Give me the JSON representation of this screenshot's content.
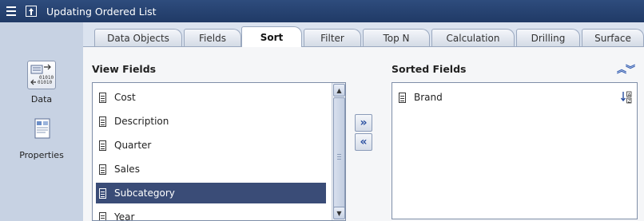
{
  "window": {
    "title": "Updating Ordered List"
  },
  "sidebar": {
    "items": [
      {
        "label": "Data",
        "icon": "data-icon"
      },
      {
        "label": "Properties",
        "icon": "properties-icon"
      }
    ]
  },
  "tabs": [
    {
      "label": "Data Objects"
    },
    {
      "label": "Fields"
    },
    {
      "label": "Sort",
      "active": true
    },
    {
      "label": "Filter"
    },
    {
      "label": "Top N"
    },
    {
      "label": "Calculation"
    },
    {
      "label": "Drilling"
    },
    {
      "label": "Surface"
    }
  ],
  "view_fields": {
    "title": "View Fields",
    "items": [
      "Cost",
      "Description",
      "Quarter",
      "Sales",
      "Subcategory",
      "Year"
    ],
    "selected": "Subcategory"
  },
  "sorted_fields": {
    "title": "Sorted Fields",
    "items": [
      {
        "label": "Brand",
        "order_icon": "sort-ascending-icon"
      }
    ]
  },
  "move_buttons": {
    "add": "»",
    "remove": "«"
  },
  "colors": {
    "titlebar": "#203a66",
    "selection": "#3a4c77",
    "accent": "#2a4fa0"
  }
}
